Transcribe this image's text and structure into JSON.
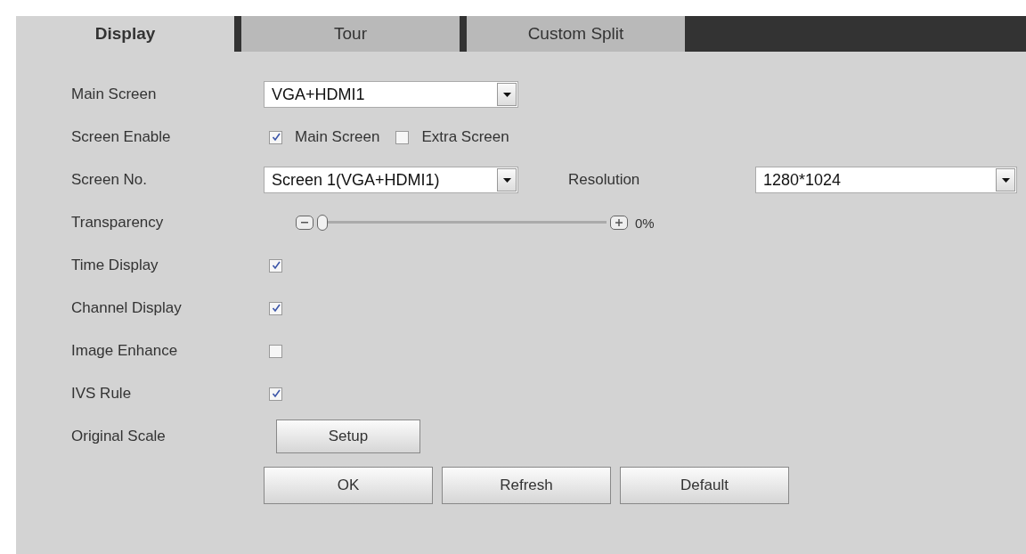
{
  "tabs": [
    {
      "label": "Display",
      "selected": true
    },
    {
      "label": "Tour",
      "selected": false
    },
    {
      "label": "Custom Split",
      "selected": false
    }
  ],
  "rows": [
    {
      "kind": "select",
      "label": "Main Screen",
      "value": "VGA+HDMI1"
    },
    {
      "kind": "checks",
      "label": "Screen Enable",
      "options": [
        {
          "label": "Main Screen",
          "checked": true
        },
        {
          "label": "Extra Screen",
          "checked": false
        }
      ]
    },
    {
      "kind": "select_pair",
      "label": "Screen No.",
      "value": "Screen 1(VGA+HDMI1)",
      "label_2": "Resolution",
      "value_2": "1280*1024"
    },
    {
      "kind": "slider",
      "label": "Transparency",
      "level": 0,
      "reading": "0%"
    },
    {
      "kind": "check",
      "label": "Time Display",
      "checked": true
    },
    {
      "kind": "check",
      "label": "Channel Display",
      "checked": true
    },
    {
      "kind": "check",
      "label": "Image Enhance",
      "checked": false
    },
    {
      "kind": "check",
      "label": "IVS Rule",
      "checked": true
    },
    {
      "kind": "button",
      "label": "Original Scale",
      "button": "Setup"
    }
  ],
  "buttons": [
    "OK",
    "Refresh",
    "Default"
  ]
}
